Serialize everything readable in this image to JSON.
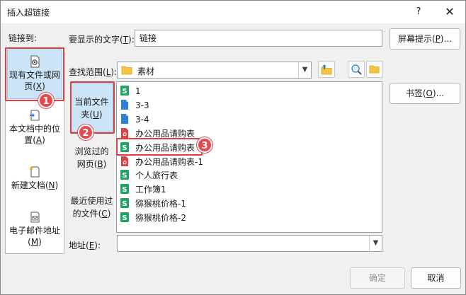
{
  "dialog": {
    "title": "插入超链接",
    "help_label": "?",
    "close_label": "✕"
  },
  "link_to": {
    "label": "链接到:",
    "items": [
      {
        "line1": "现有文件或网",
        "line2": "页(",
        "key": "X",
        "line2_end": ")",
        "icon": "existing-file-icon",
        "selected": true
      },
      {
        "line1": "本文档中的位",
        "line2": "置(",
        "key": "A",
        "line2_end": ")",
        "icon": "place-in-document-icon"
      },
      {
        "line1": "新建文档(",
        "key": "N",
        "line1_end": ")",
        "icon": "new-document-icon"
      },
      {
        "line1": "电子邮件地址",
        "line2": "(",
        "key": "M",
        "line2_end": ")",
        "icon": "email-address-icon"
      }
    ]
  },
  "display_text": {
    "label": "要显示的文字(",
    "key": "T",
    "label_end": "):",
    "value": "链接"
  },
  "screentip_button": {
    "label": "屏幕提示(",
    "key": "P",
    "label_end": ")..."
  },
  "look_in": {
    "label": "查找范围(",
    "key": "L",
    "label_end": "):",
    "value": "素材"
  },
  "look_in_nav": {
    "items": [
      {
        "line1": "当前文件",
        "line2": "夹(",
        "key": "U",
        "line2_end": ")",
        "selected": true
      },
      {
        "line1": "浏览过的",
        "line2": "网页(",
        "key": "B",
        "line2_end": ")"
      },
      {
        "line1": "最近使用过",
        "line2": "的文件(",
        "key": "C",
        "line2_end": ")"
      }
    ]
  },
  "bookmark_button": {
    "label": "书签(",
    "key": "O",
    "label_end": ")..."
  },
  "files": [
    {
      "name": "1",
      "type": "excel"
    },
    {
      "name": "3-3",
      "type": "doc"
    },
    {
      "name": "3-4",
      "type": "doc"
    },
    {
      "name": "办公用品请购表",
      "type": "pdf"
    },
    {
      "name": "办公用品请购表",
      "type": "excel",
      "highlight": true
    },
    {
      "name": "办公用品请购表-1",
      "type": "pdf"
    },
    {
      "name": "个人旅行表",
      "type": "excel"
    },
    {
      "name": "工作簿1",
      "type": "excel"
    },
    {
      "name": "猕猴桃价格-1",
      "type": "excel"
    },
    {
      "name": "猕猴桃价格-2",
      "type": "excel"
    }
  ],
  "address": {
    "label": "地址(",
    "key": "E",
    "label_end": "):",
    "value": ""
  },
  "ok_button": {
    "label": "确定"
  },
  "cancel_button": {
    "label": "取消"
  },
  "callouts": [
    "1",
    "2",
    "3"
  ],
  "colors": {
    "accent_red": "#e23d3d",
    "selection": "#cce4f7",
    "excel_green": "#21a366",
    "doc_blue": "#2f7fd3",
    "pdf_red": "#d9414a"
  }
}
